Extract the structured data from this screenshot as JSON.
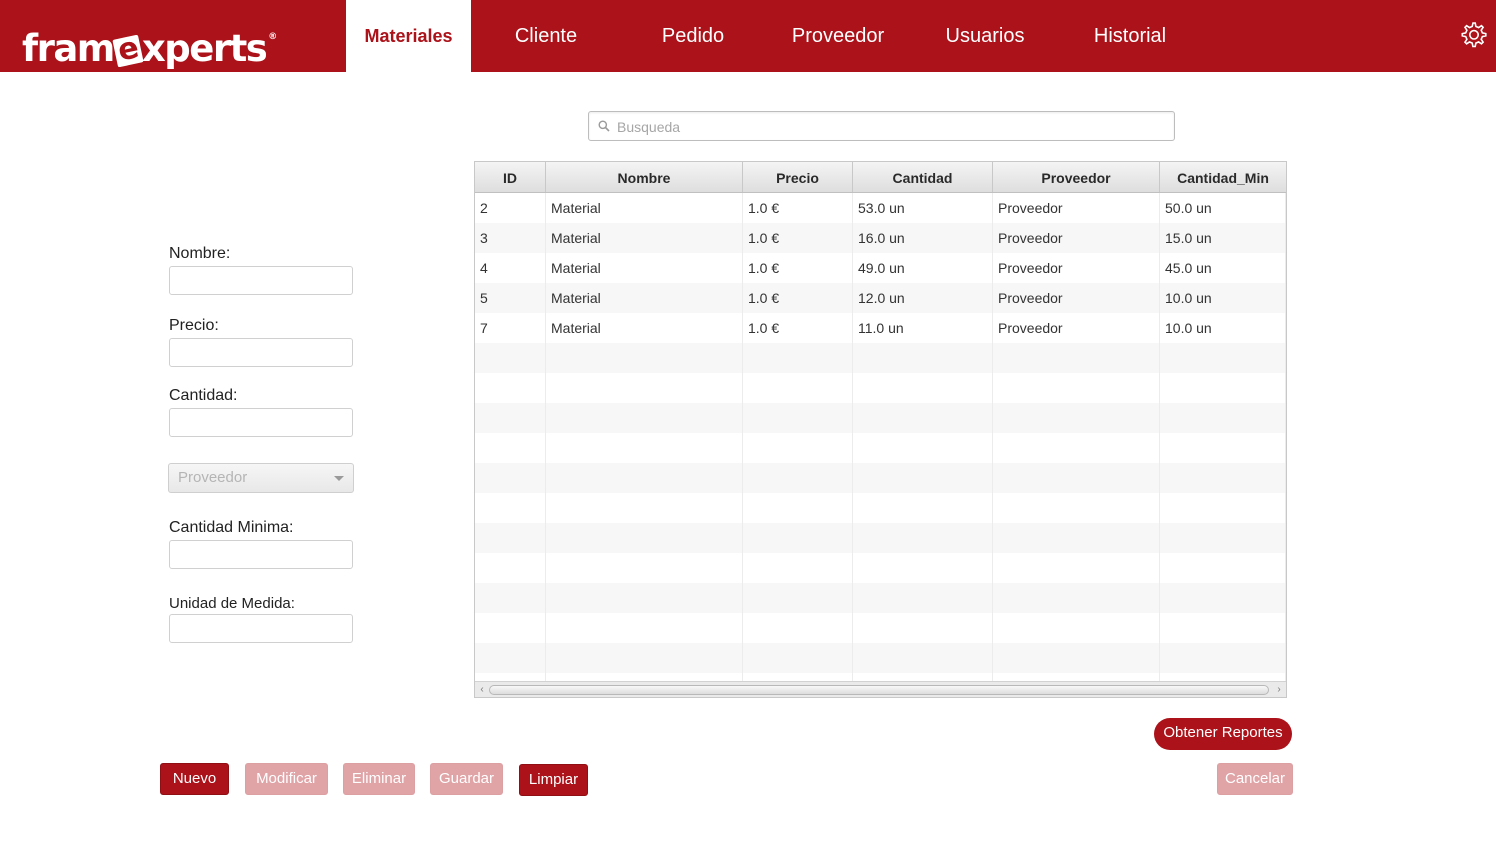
{
  "header": {
    "logo_pre": "fram",
    "logo_e": "e",
    "logo_post": "xperts",
    "logo_reg": "®",
    "tabs": [
      {
        "label": "Materiales"
      },
      {
        "label": "Cliente"
      },
      {
        "label": "Pedido"
      },
      {
        "label": "Proveedor"
      },
      {
        "label": "Usuarios"
      },
      {
        "label": "Historial"
      }
    ],
    "active_tab": "Materiales",
    "settings_icon": "gear-icon"
  },
  "form": {
    "nombre_label": "Nombre:",
    "precio_label": "Precio:",
    "cantidad_label": "Cantidad:",
    "proveedor_placeholder": "Proveedor",
    "cantidad_minima_label": "Cantidad Minima:",
    "unidad_label": "Unidad de Medida:"
  },
  "search": {
    "placeholder": "Busqueda",
    "icon": "search-icon"
  },
  "table": {
    "columns": [
      "ID",
      "Nombre",
      "Precio",
      "Cantidad",
      "Proveedor",
      "Cantidad_Min"
    ],
    "rows": [
      [
        "2",
        "Material",
        "1.0 €",
        "53.0 un",
        "Proveedor",
        "50.0 un"
      ],
      [
        "3",
        "Material",
        "1.0 €",
        "16.0 un",
        "Proveedor",
        "15.0 un"
      ],
      [
        "4",
        "Material",
        "1.0 €",
        "49.0 un",
        "Proveedor",
        "45.0 un"
      ],
      [
        "5",
        "Material",
        "1.0 €",
        "12.0 un",
        "Proveedor",
        "10.0 un"
      ],
      [
        "7",
        "Material",
        "1.0 €",
        "11.0 un",
        "Proveedor",
        "10.0 un"
      ]
    ]
  },
  "buttons": {
    "reportes": "Obtener Reportes",
    "nuevo": "Nuevo",
    "modificar": "Modificar",
    "eliminar": "Eliminar",
    "guardar": "Guardar",
    "limpiar": "Limpiar",
    "cancelar": "Cancelar"
  },
  "colors": {
    "brand": "#ab1219",
    "disabled": "#e0a3a6"
  }
}
